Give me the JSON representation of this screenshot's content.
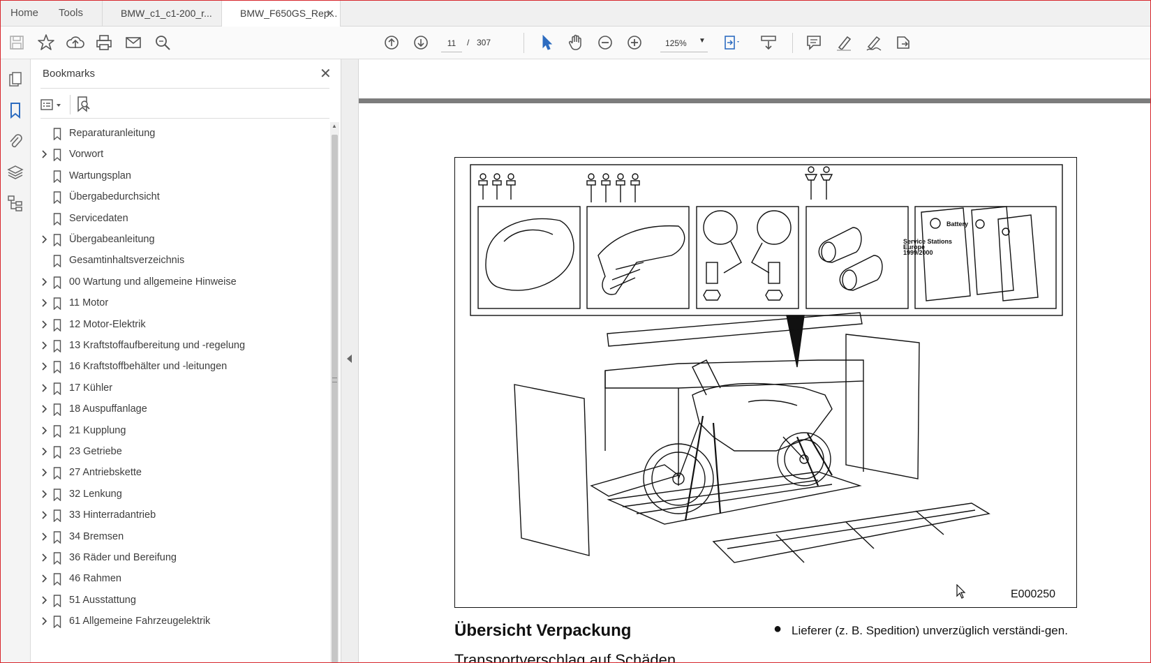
{
  "tabbar": {
    "home": "Home",
    "tools": "Tools",
    "tabs": [
      {
        "label": "BMW_c1_c1-200_r..."
      },
      {
        "label": "BMW_F650GS_Rep...",
        "close": "✕"
      }
    ]
  },
  "toolbar": {
    "page_current": "11",
    "page_sep": "/",
    "page_total": "307",
    "zoom": "125%",
    "icons": [
      "save-icon",
      "bookmark-star-icon",
      "upload-cloud-icon",
      "print-icon",
      "email-icon",
      "search-zoom-icon",
      "page-up-icon",
      "page-down-icon",
      "select-cursor-icon",
      "hand-pan-icon",
      "zoom-out-icon",
      "zoom-in-icon",
      "fit-page-icon",
      "scroll-mode-icon",
      "comment-icon",
      "highlight-pen-icon",
      "sign-icon",
      "share-icon"
    ]
  },
  "rail": {
    "icons": [
      "pages-icon",
      "bookmarks-icon",
      "attachments-icon",
      "layers-icon",
      "structure-icon"
    ]
  },
  "bookmarks": {
    "title": "Bookmarks",
    "close": "✕",
    "items": [
      {
        "label": "Reparaturanleitung",
        "expandable": false
      },
      {
        "label": "Vorwort",
        "expandable": true
      },
      {
        "label": "Wartungsplan",
        "expandable": false
      },
      {
        "label": "Übergabedurchsicht",
        "expandable": false
      },
      {
        "label": "Servicedaten",
        "expandable": false
      },
      {
        "label": "Übergabeanleitung",
        "expandable": true
      },
      {
        "label": "Gesamtinhaltsverzeichnis",
        "expandable": false
      },
      {
        "label": "00 Wartung und allgemeine Hinweise",
        "expandable": true
      },
      {
        "label": "11 Motor",
        "expandable": true
      },
      {
        "label": "12 Motor-Elektrik",
        "expandable": true
      },
      {
        "label": "13 Kraftstoffaufbereitung und -regelung",
        "expandable": true
      },
      {
        "label": "16 Kraftstoffbehälter und -leitungen",
        "expandable": true
      },
      {
        "label": "17 Kühler",
        "expandable": true
      },
      {
        "label": "18 Auspuffanlage",
        "expandable": true
      },
      {
        "label": "21 Kupplung",
        "expandable": true
      },
      {
        "label": "23 Getriebe",
        "expandable": true
      },
      {
        "label": "27 Antriebskette",
        "expandable": true
      },
      {
        "label": "32 Lenkung",
        "expandable": true
      },
      {
        "label": "33 Hinterradantrieb",
        "expandable": true
      },
      {
        "label": "34 Bremsen",
        "expandable": true
      },
      {
        "label": "36 Räder und Bereifung",
        "expandable": true
      },
      {
        "label": "46 Rahmen",
        "expandable": true
      },
      {
        "label": "51 Ausstattung",
        "expandable": true
      },
      {
        "label": "61 Allgemeine Fahrzeugelektrik",
        "expandable": true
      }
    ]
  },
  "document": {
    "figure_code": "E000250",
    "figure_texts": {
      "battery": "Battery",
      "service_stations": "Service Stations",
      "europe": "Europe",
      "years": "1999/2000"
    },
    "heading": "Übersicht Verpackung",
    "subheading": "Transportverschlag auf Schäden",
    "bullet": "Lieferer (z. B. Spedition) unverzüglich verständi-gen."
  },
  "colors": {
    "frame": "#d7262c",
    "accent_blue": "#2d6cc0",
    "page_bar": "#7c7c7c"
  }
}
